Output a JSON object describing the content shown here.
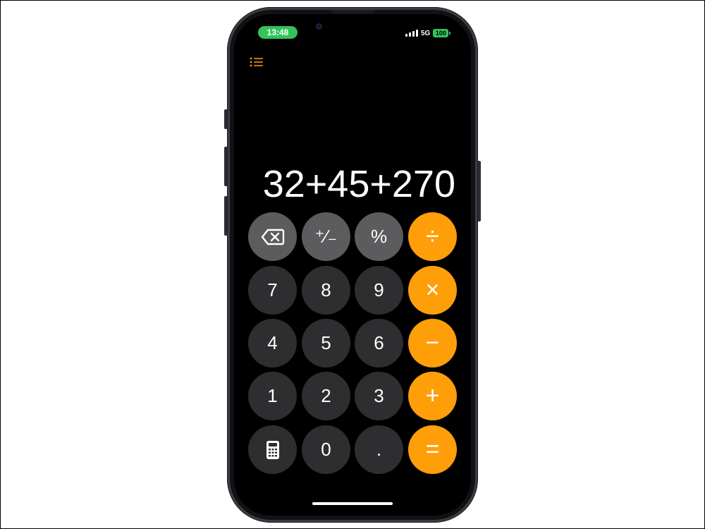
{
  "status_bar": {
    "time": "13:48",
    "network": "5G",
    "battery": "100"
  },
  "colors": {
    "accent_orange": "#fe9f0a",
    "function_gray": "#5c5c5e",
    "digit_gray": "#2e2e30",
    "time_pill_green": "#32c45a",
    "background": "#000000"
  },
  "header": {
    "history_icon": "list-icon"
  },
  "display": {
    "expression": "32+45+270"
  },
  "keypad": {
    "row1": {
      "backspace_icon": "backspace-icon",
      "plus_minus": "⁺∕₋",
      "percent": "%",
      "divide": "÷"
    },
    "row2": {
      "seven": "7",
      "eight": "8",
      "nine": "9",
      "multiply": "×"
    },
    "row3": {
      "four": "4",
      "five": "5",
      "six": "6",
      "minus": "−"
    },
    "row4": {
      "one": "1",
      "two": "2",
      "three": "3",
      "plus": "+"
    },
    "row5": {
      "calculator_icon": "calculator-icon",
      "zero": "0",
      "decimal": ".",
      "equals": "="
    }
  }
}
